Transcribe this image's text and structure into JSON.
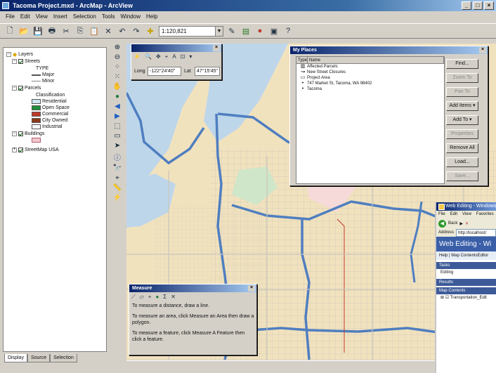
{
  "window": {
    "title": "Tacoma Project.mxd - ArcMap - ArcView"
  },
  "menu": [
    "File",
    "Edit",
    "View",
    "Insert",
    "Selection",
    "Tools",
    "Window",
    "Help"
  ],
  "toolbar": {
    "scale": "1:120,821"
  },
  "toc": {
    "root": "Layers",
    "layers": [
      {
        "label": "Streets"
      },
      {
        "label": "TYPE"
      },
      {
        "label": "Major"
      },
      {
        "label": "Minor"
      },
      {
        "label": "Parcels"
      },
      {
        "label": "Classification"
      },
      {
        "label": "Residential",
        "color": "#cde7f0"
      },
      {
        "label": "Open Space",
        "color": "#1f8f3a"
      },
      {
        "label": "Commercial",
        "color": "#c0392b"
      },
      {
        "label": "City Owned",
        "color": "#8b3a1a"
      },
      {
        "label": "Industrial",
        "color": "#ffffff"
      },
      {
        "label": "Buildings"
      },
      {
        "label": "StreetMap USA"
      }
    ],
    "tabs": [
      "Display",
      "Source",
      "Selection"
    ]
  },
  "goto_xy": {
    "long_label": "Long",
    "long_value": "-122°24'40\"",
    "lat_label": "Lat",
    "lat_value": "47°15'45\""
  },
  "my_places": {
    "title": "My Places",
    "columns": [
      "Type",
      "Name"
    ],
    "items": [
      {
        "icon": "▥",
        "name": "Affected Parcels"
      },
      {
        "icon": "↝",
        "name": "New Street Closures"
      },
      {
        "icon": "▭",
        "name": "Project Area"
      },
      {
        "icon": "•",
        "name": "747 Market St, Tacoma, WA 98402"
      },
      {
        "icon": "•",
        "name": "Tacoma"
      }
    ],
    "buttons": [
      {
        "label": "Find...",
        "disabled": false
      },
      {
        "label": "Zoom To",
        "disabled": true
      },
      {
        "label": "Pan To",
        "disabled": true
      },
      {
        "label": "Add Items ▾",
        "disabled": false
      },
      {
        "label": "Add To ▾",
        "disabled": false
      },
      {
        "label": "Properties",
        "disabled": true
      },
      {
        "label": "Remove All",
        "disabled": false
      },
      {
        "label": "Load...",
        "disabled": false
      },
      {
        "label": "Save...",
        "disabled": true
      }
    ]
  },
  "measure": {
    "title": "Measure",
    "instructions": [
      "To measure a distance, draw a line.",
      "To measure an area, click Measure an Area then draw a polygon.",
      "To measure a feature, click Measure A Feature then click a feature."
    ]
  },
  "browser": {
    "title": "Web Editing - Windows Internet Explorer",
    "menu": [
      "File",
      "Edit",
      "View",
      "Favorites"
    ],
    "nav_back": "Back",
    "address_label": "Address",
    "address": "http://localhost/",
    "heading": "Web Editing - Wi",
    "help": "Help | Map ContentsEditor",
    "sections": [
      {
        "title": "Tasks",
        "items": [
          "Editing"
        ]
      },
      {
        "title": "Results",
        "items": []
      },
      {
        "title": "Map Contents",
        "items": [
          "Transportation_Edit"
        ]
      }
    ]
  },
  "colors": {
    "map_background": "#f1e2be",
    "water": "#bed6ea",
    "major_road": "#4f7ec0",
    "minor_road": "#c9c5bb",
    "titlebar": "#0a246a"
  }
}
